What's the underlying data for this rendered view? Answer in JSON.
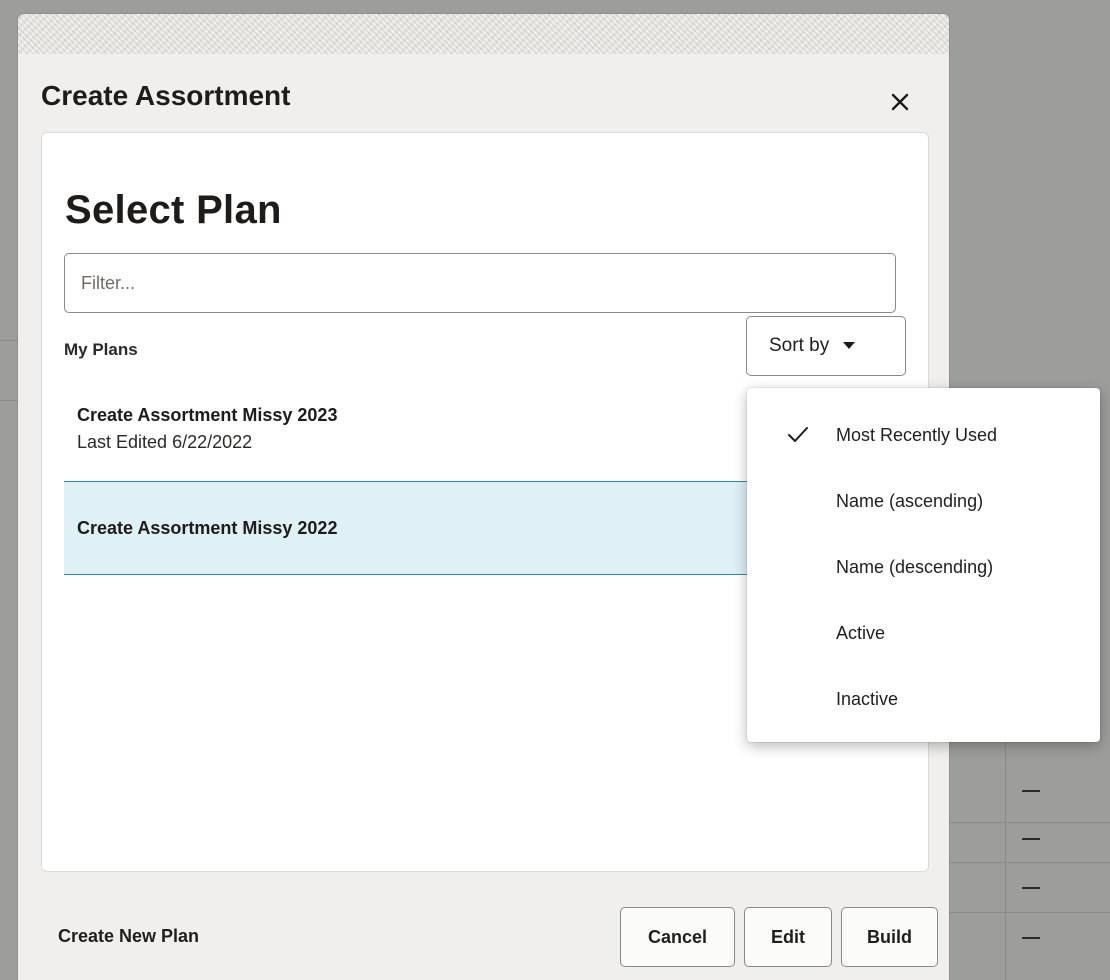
{
  "dialog": {
    "title": "Create Assortment",
    "close_label": "×"
  },
  "panel": {
    "heading": "Select Plan",
    "filter_placeholder": "Filter...",
    "section_label": "My Plans",
    "sort_label": "Sort by"
  },
  "plans": [
    {
      "name": "Create Assortment Missy 2023",
      "subtitle": "Last Edited 6/22/2022",
      "selected": false
    },
    {
      "name": "Create Assortment Missy 2022",
      "subtitle": "",
      "selected": true
    }
  ],
  "sort_menu": {
    "items": [
      {
        "label": "Most Recently Used",
        "checked": true
      },
      {
        "label": "Name (ascending)",
        "checked": false
      },
      {
        "label": "Name (descending)",
        "checked": false
      },
      {
        "label": "Active",
        "checked": false
      },
      {
        "label": "Inactive",
        "checked": false
      }
    ]
  },
  "footer": {
    "create_new_label": "Create New Plan",
    "cancel_label": "Cancel",
    "edit_label": "Edit",
    "build_label": "Build"
  },
  "colors": {
    "overlay": "#9d9d9b",
    "selected_row": "#dff0f7",
    "selected_border": "#2f8a9f"
  }
}
